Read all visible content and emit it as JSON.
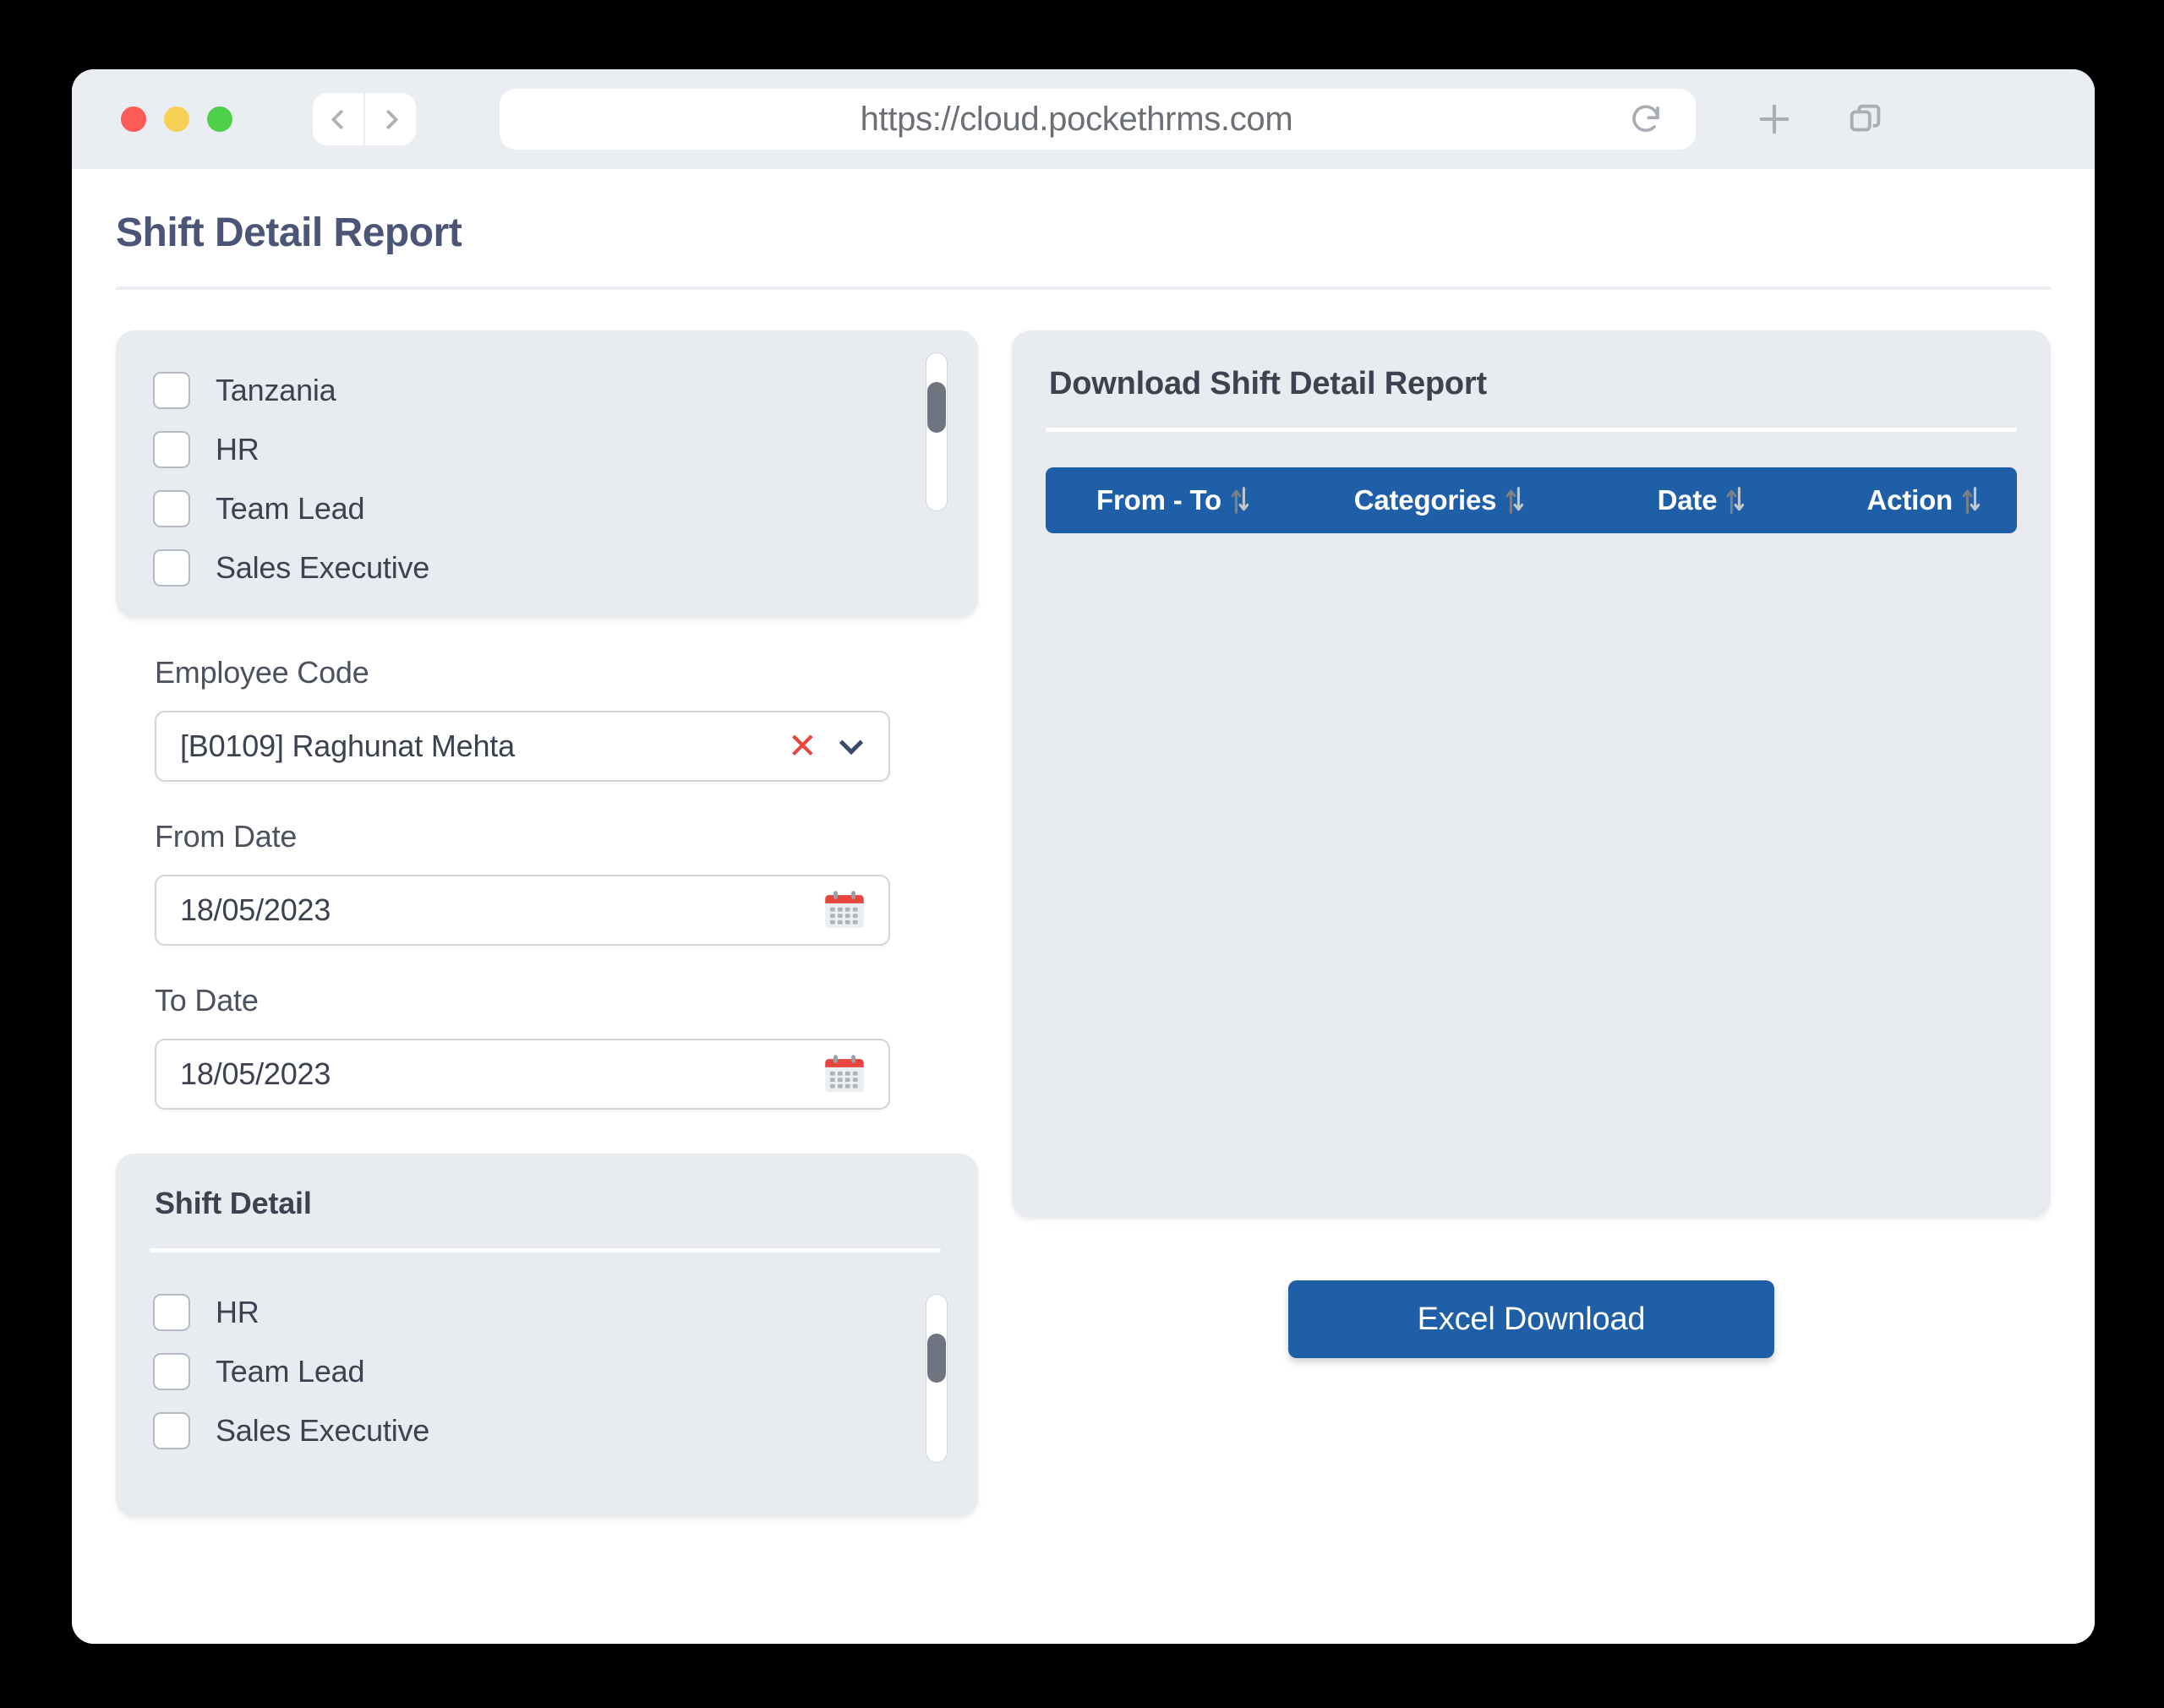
{
  "browser": {
    "url": "https://cloud.pockethrms.com",
    "icons": {
      "back": "chevron-left-icon",
      "forward": "chevron-right-icon",
      "reload": "reload-icon",
      "new_tab": "plus-icon",
      "tabs": "tabs-icon"
    }
  },
  "page": {
    "title": "Shift Detail Report"
  },
  "category_list": {
    "items": [
      {
        "label": "Tanzania",
        "checked": false
      },
      {
        "label": "HR",
        "checked": false
      },
      {
        "label": "Team Lead",
        "checked": false
      },
      {
        "label": "Sales Executive",
        "checked": false
      }
    ]
  },
  "employee_code": {
    "label": "Employee Code",
    "value": "[B0109] Raghunat Mehta",
    "clear_icon": "close-icon",
    "dropdown_icon": "chevron-down-icon"
  },
  "from_date": {
    "label": "From Date",
    "value": "18/05/2023",
    "icon": "calendar-icon"
  },
  "to_date": {
    "label": "To Date",
    "value": "18/05/2023",
    "icon": "calendar-icon"
  },
  "shift_detail": {
    "heading": "Shift Detail",
    "items": [
      {
        "label": "HR",
        "checked": false
      },
      {
        "label": "Team Lead",
        "checked": false
      },
      {
        "label": "Sales Executive",
        "checked": false
      }
    ]
  },
  "report": {
    "heading": "Download Shift Detail Report",
    "columns": [
      {
        "label": "From - To",
        "sort_icon": "sort-icon"
      },
      {
        "label": "Categories",
        "sort_icon": "sort-icon"
      },
      {
        "label": "Date",
        "sort_icon": "sort-icon"
      },
      {
        "label": "Action",
        "sort_icon": "sort-icon"
      }
    ],
    "rows": [],
    "download_button": "Excel Download"
  },
  "colors": {
    "accent_blue": "#1f5fa8",
    "title_blue": "#4a5578",
    "panel_bg": "#e8ebf0",
    "clear_red": "#e8453c"
  }
}
